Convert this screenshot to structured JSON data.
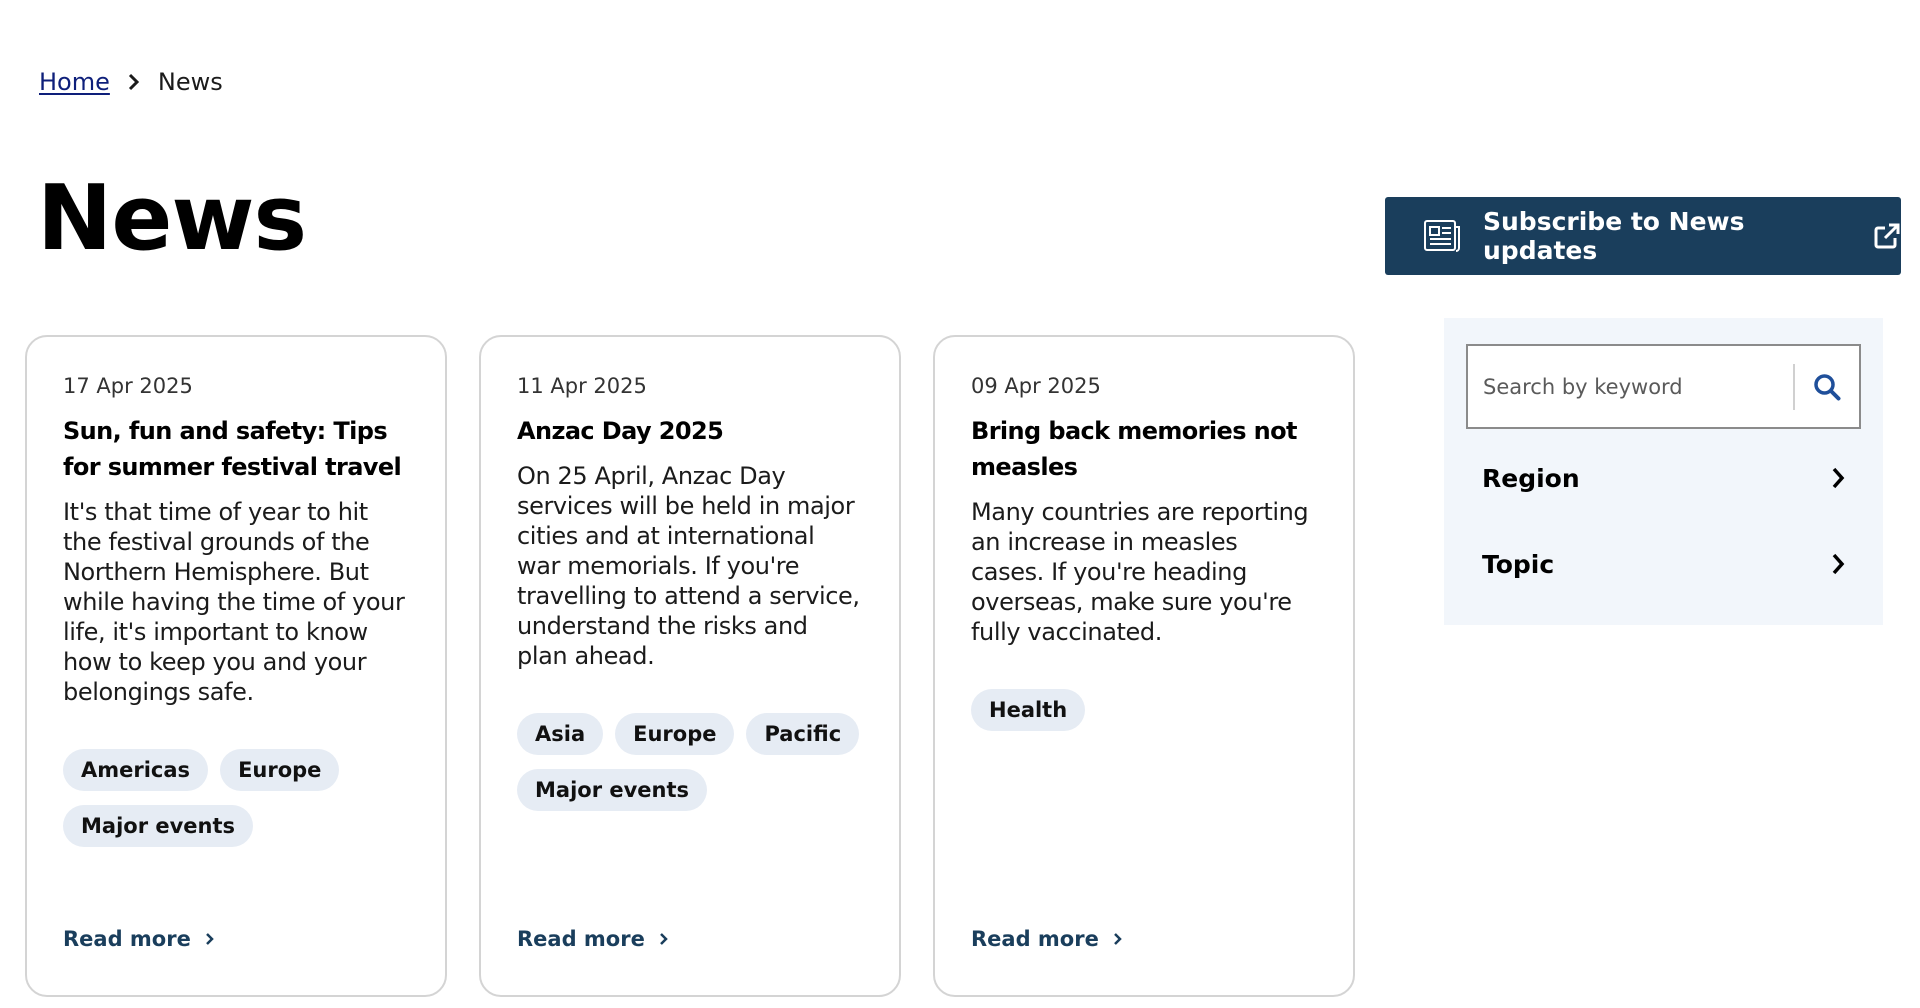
{
  "breadcrumb": {
    "home": "Home",
    "current": "News"
  },
  "page": {
    "title": "News"
  },
  "subscribe": {
    "label": "Subscribe to News updates",
    "bg": "#1a3e5c"
  },
  "cards": [
    {
      "date": "17 Apr 2025",
      "title": "Sun, fun and safety: Tips for summer festival travel",
      "summary": "It's that time of year to hit the festival grounds of the Northern Hemisphere. But while having the time of your life, it's important to know how to keep you and your belongings safe.",
      "tags": [
        "Americas",
        "Europe",
        "Major events"
      ],
      "read_more": "Read more"
    },
    {
      "date": "11 Apr 2025",
      "title": "Anzac Day 2025",
      "summary": "On 25 April, Anzac Day services will be held in major cities and at international war memorials. If you're travelling to attend a service, understand the risks and plan ahead.",
      "tags": [
        "Asia",
        "Europe",
        "Pacific",
        "Major events"
      ],
      "read_more": "Read more"
    },
    {
      "date": "09 Apr 2025",
      "title": "Bring back memories not measles",
      "summary": "Many countries are reporting an increase in measles cases. If you're heading overseas, make sure you're fully vaccinated.",
      "tags": [
        "Health"
      ],
      "read_more": "Read more"
    }
  ],
  "search": {
    "placeholder": "Search by keyword"
  },
  "filters": [
    {
      "label": "Region"
    },
    {
      "label": "Topic"
    }
  ],
  "icons": {
    "chevron": "chevron-right-icon",
    "subscribe": "newspaper-icon",
    "external": "external-link-icon",
    "search": "search-icon"
  },
  "colors": {
    "accent": "#1a3e5c",
    "tag_bg": "#e6ecf4",
    "panel_bg": "#f2f6fb",
    "link": "#0e1f7a"
  }
}
